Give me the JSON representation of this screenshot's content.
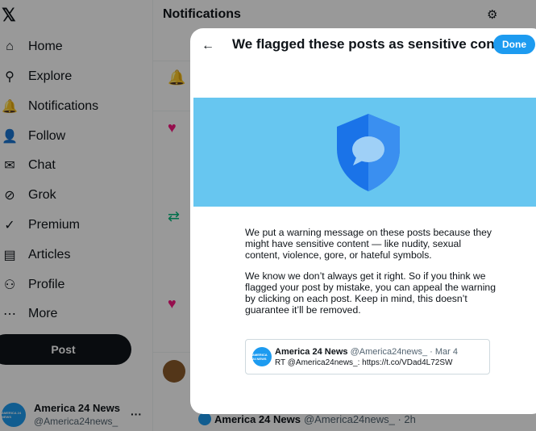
{
  "sidebar": {
    "logo": "𝕏",
    "items": [
      {
        "label": "Home",
        "icon": "⌂"
      },
      {
        "label": "Explore",
        "icon": "⚲"
      },
      {
        "label": "Notifications",
        "icon": "🔔"
      },
      {
        "label": "Follow",
        "icon": "👤"
      },
      {
        "label": "Chat",
        "icon": "✉"
      },
      {
        "label": "Grok",
        "icon": "⊘"
      },
      {
        "label": "Premium",
        "icon": "✓"
      },
      {
        "label": "Articles",
        "icon": "▤"
      },
      {
        "label": "Profile",
        "icon": "⚇"
      },
      {
        "label": "More",
        "icon": "⋯"
      }
    ],
    "post_label": "Post",
    "account": {
      "avatar_text": "AMERICA 24 NEWS",
      "name": "America 24 News",
      "handle": "@America24news_",
      "more_icon": "···"
    }
  },
  "main": {
    "title": "Notifications",
    "gear_icon": "⚙",
    "feed_icons": [
      "🔔",
      "♥",
      "⇄",
      "♥"
    ],
    "bottom_post": {
      "name": "America 24 News",
      "meta": "@America24news_ · 2h"
    }
  },
  "modal": {
    "back_icon": "←",
    "title": "We flagged these posts as sensitive content",
    "done_label": "Done",
    "paragraph1": "We put a warning message on these posts because they might have sensitive content — like nudity, sexual content, violence, gore, or hateful symbols.",
    "paragraph2": "We know we don’t always get it right. So if you think we flagged your post by mistake, you can appeal the warning by clicking on each post. Keep in mind, this doesn’t guarantee it’ll be removed.",
    "post": {
      "avatar_text": "AMERICA 24 NEWS",
      "name": "America 24 News",
      "meta": "@America24news_ · Mar 4",
      "text": "RT @America24news_: https://t.co/VDad4L72SW"
    }
  },
  "colors": {
    "accent": "#1d9bf0",
    "banner": "#67c6f0",
    "shield_dark": "#1a73e8",
    "shield_light": "#3a8ff0"
  }
}
